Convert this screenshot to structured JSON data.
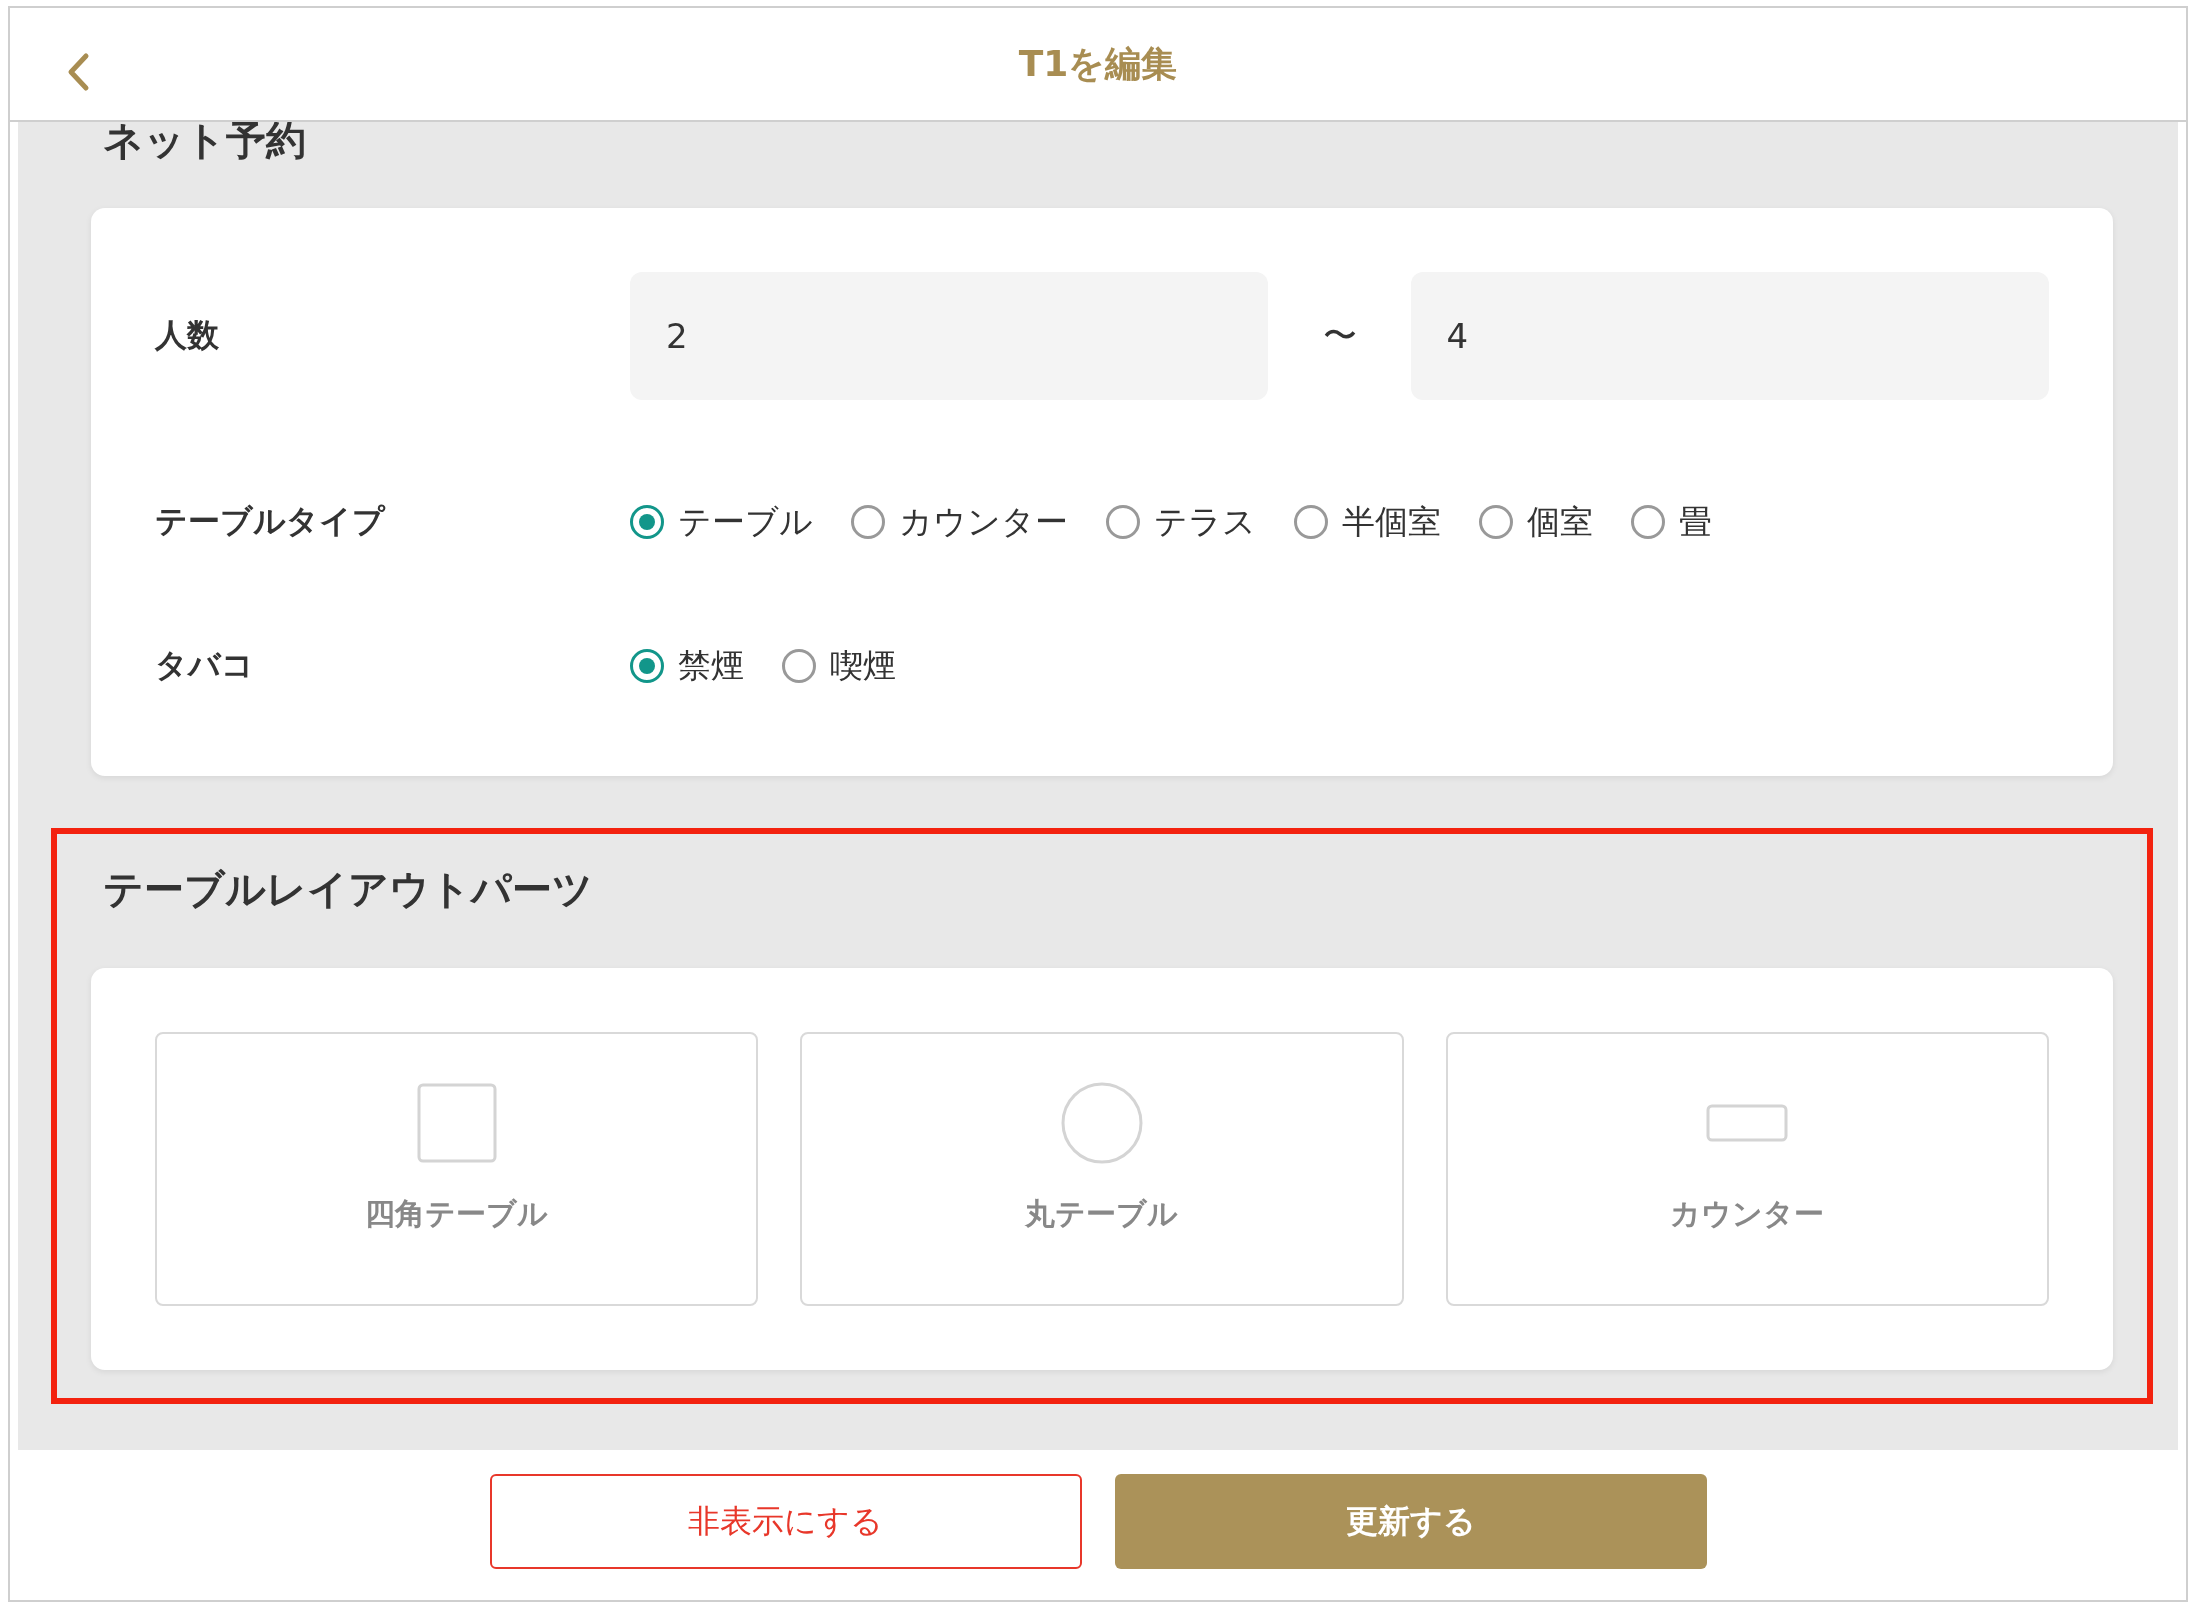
{
  "header": {
    "title": "T1を編集"
  },
  "online_booking": {
    "heading": "ネット予約",
    "party_size": {
      "label": "人数",
      "min": "2",
      "separator": "〜",
      "max": "4"
    },
    "table_type": {
      "label": "テーブルタイプ",
      "options": [
        {
          "label": "テーブル",
          "selected": true
        },
        {
          "label": "カウンター",
          "selected": false
        },
        {
          "label": "テラス",
          "selected": false
        },
        {
          "label": "半個室",
          "selected": false
        },
        {
          "label": "個室",
          "selected": false
        },
        {
          "label": "畳",
          "selected": false
        }
      ]
    },
    "smoking": {
      "label": "タバコ",
      "options": [
        {
          "label": "禁煙",
          "selected": true
        },
        {
          "label": "喫煙",
          "selected": false
        }
      ]
    }
  },
  "layout_parts": {
    "heading": "テーブルレイアウトパーツ",
    "highlighted": true,
    "parts": [
      {
        "kind": "square",
        "label": "四角テーブル"
      },
      {
        "kind": "round",
        "label": "丸テーブル"
      },
      {
        "kind": "counter",
        "label": "カウンター"
      }
    ]
  },
  "buttons": [
    {
      "kind": "outline",
      "label": "非表示にする"
    },
    {
      "kind": "primary",
      "label": "更新する"
    }
  ]
}
